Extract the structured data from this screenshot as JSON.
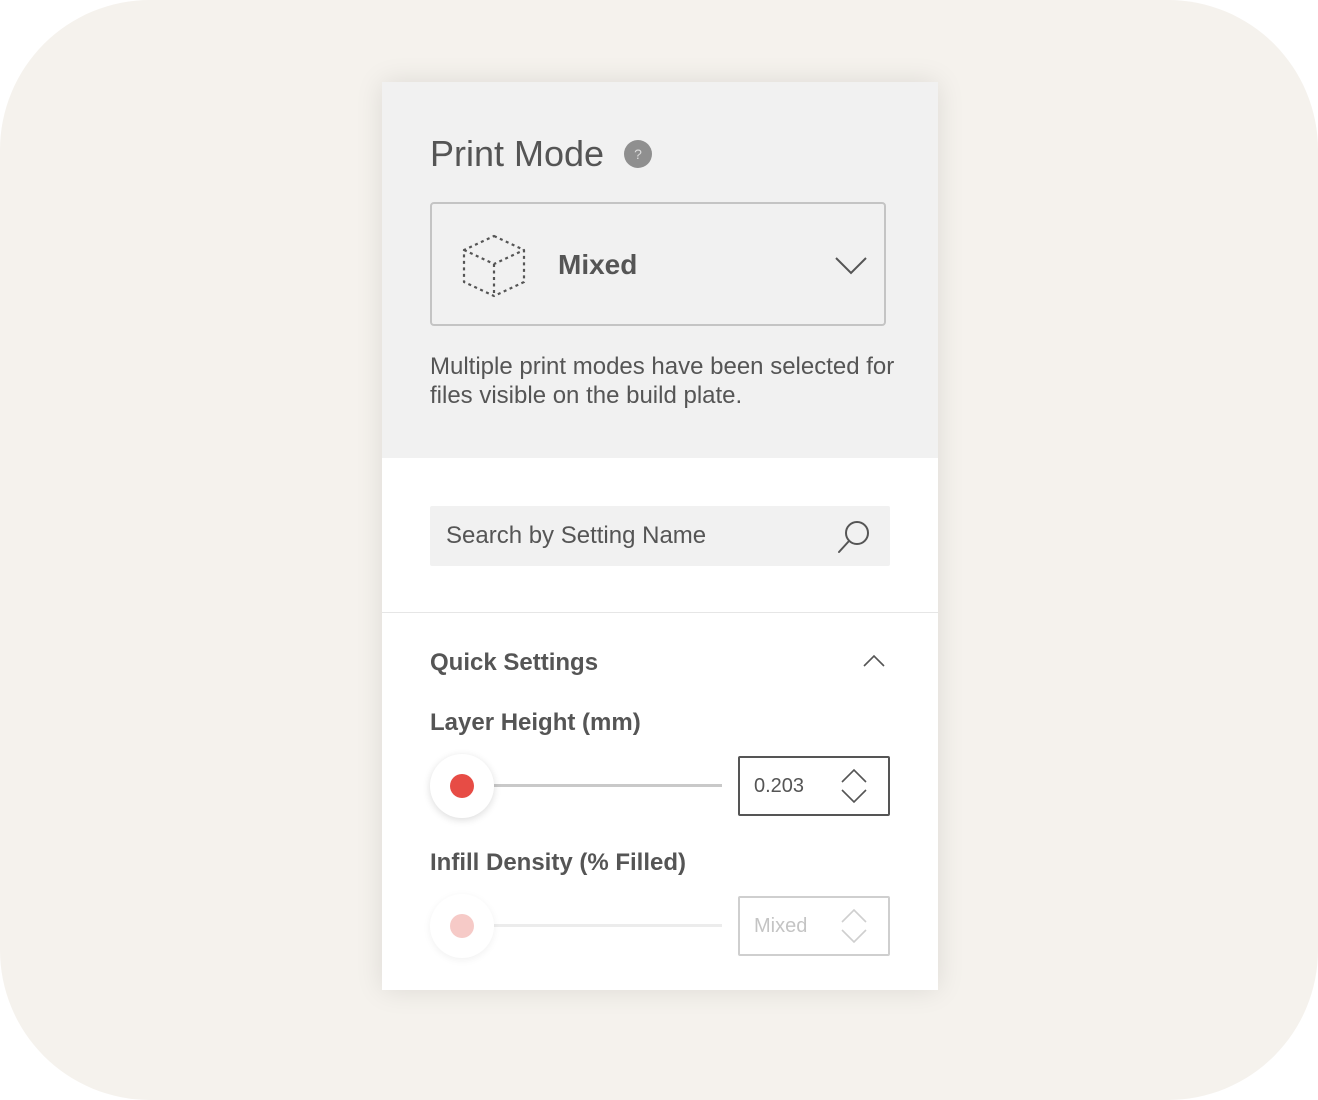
{
  "print_mode": {
    "title": "Print Mode",
    "help_glyph": "?",
    "selected_mode": "Mixed",
    "mode_icon": "dashed-cube-icon",
    "description": "Multiple print modes have been selected for files visible on the build plate."
  },
  "search": {
    "placeholder": "Search by Setting Name",
    "icon": "search-icon"
  },
  "quick_settings": {
    "title": "Quick Settings",
    "expanded": true,
    "layer_height": {
      "label": "Layer Height (mm)",
      "value": "0.203",
      "enabled": true
    },
    "infill_density": {
      "label": "Infill Density (% Filled)",
      "value": "Mixed",
      "enabled": false
    }
  },
  "colors": {
    "accent": "#e74c45",
    "accent_disabled": "#f6cac7",
    "text": "#555555",
    "panel_gray": "#f1f1f1",
    "backdrop": "#f5f2ed"
  }
}
